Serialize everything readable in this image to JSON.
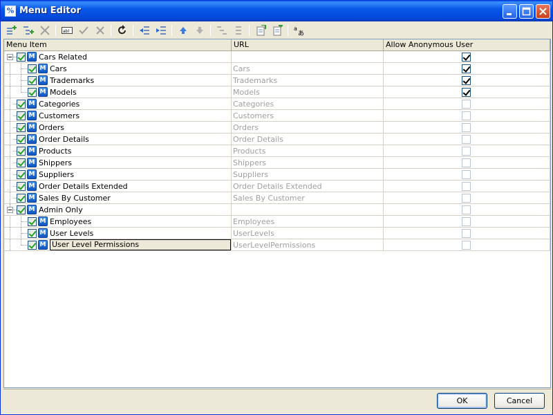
{
  "window": {
    "title": "Menu Editor"
  },
  "columns": {
    "menu_item": "Menu Item",
    "url": "URL",
    "anonymous": "Allow Anonymous User"
  },
  "rows": [
    {
      "label": "Cars Related",
      "url": "",
      "level": 0,
      "group": true,
      "checked": true,
      "anonymous": true
    },
    {
      "label": "Cars",
      "url": "Cars",
      "level": 1,
      "group": false,
      "checked": true,
      "anonymous": true
    },
    {
      "label": "Trademarks",
      "url": "Trademarks",
      "level": 1,
      "group": false,
      "checked": true,
      "anonymous": true
    },
    {
      "label": "Models",
      "url": "Models",
      "level": 1,
      "group": false,
      "checked": true,
      "anonymous": true
    },
    {
      "label": "Categories",
      "url": "Categories",
      "level": 0,
      "group": false,
      "checked": true,
      "anonymous": false
    },
    {
      "label": "Customers",
      "url": "Customers",
      "level": 0,
      "group": false,
      "checked": true,
      "anonymous": false
    },
    {
      "label": "Orders",
      "url": "Orders",
      "level": 0,
      "group": false,
      "checked": true,
      "anonymous": false
    },
    {
      "label": "Order Details",
      "url": "Order Details",
      "level": 0,
      "group": false,
      "checked": true,
      "anonymous": false
    },
    {
      "label": "Products",
      "url": "Products",
      "level": 0,
      "group": false,
      "checked": true,
      "anonymous": false
    },
    {
      "label": "Shippers",
      "url": "Shippers",
      "level": 0,
      "group": false,
      "checked": true,
      "anonymous": false
    },
    {
      "label": "Suppliers",
      "url": "Suppliers",
      "level": 0,
      "group": false,
      "checked": true,
      "anonymous": false
    },
    {
      "label": "Order Details Extended",
      "url": "Order Details Extended",
      "level": 0,
      "group": false,
      "checked": true,
      "anonymous": false
    },
    {
      "label": "Sales By Customer",
      "url": "Sales By Customer",
      "level": 0,
      "group": false,
      "checked": true,
      "anonymous": false
    },
    {
      "label": "Admin Only",
      "url": "",
      "level": 0,
      "group": true,
      "checked": true,
      "anonymous": false
    },
    {
      "label": "Employees",
      "url": "Employees",
      "level": 1,
      "group": false,
      "checked": true,
      "anonymous": false
    },
    {
      "label": "User Levels",
      "url": "UserLevels",
      "level": 1,
      "group": false,
      "checked": true,
      "anonymous": false
    },
    {
      "label": "User Level Permissions",
      "url": "UserLevelPermissions",
      "level": 1,
      "group": false,
      "checked": true,
      "anonymous": false,
      "selected": true
    }
  ],
  "menu_icon_letter": "M",
  "buttons": {
    "ok": "OK",
    "cancel": "Cancel"
  },
  "colors": {
    "title_bar": "#0858e8",
    "url_text": "#a0a0a0",
    "check_green": "#21a121"
  }
}
